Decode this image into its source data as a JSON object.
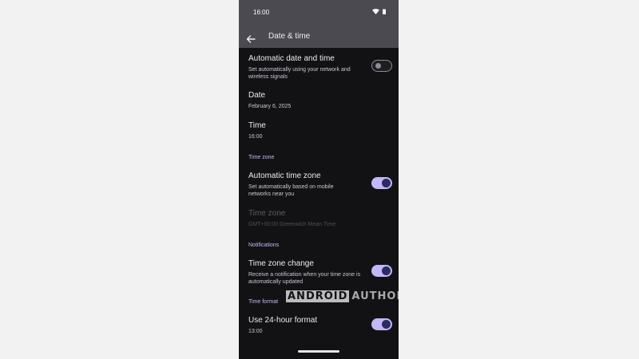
{
  "status_bar": {
    "time": "16:00"
  },
  "app_bar": {
    "title": "Date & time"
  },
  "settings": {
    "auto_date_time": {
      "title": "Automatic date and time",
      "subtitle": "Set automatically using your network and wireless signals",
      "enabled": false
    },
    "date": {
      "title": "Date",
      "value": "February 6, 2025"
    },
    "time": {
      "title": "Time",
      "value": "16:00"
    },
    "time_zone_header": "Time zone",
    "auto_time_zone": {
      "title": "Automatic time zone",
      "subtitle": "Set automatically based on mobile networks near you",
      "enabled": true
    },
    "time_zone": {
      "title": "Time zone",
      "value": "GMT+00:00 Greenwich Mean Time",
      "disabled": true
    },
    "notifications_header": "Notifications",
    "time_zone_change": {
      "title": "Time zone change",
      "subtitle": "Receive a notification when your time zone is automatically updated",
      "enabled": true
    },
    "time_format_header": "Time format",
    "use_24_hour": {
      "title": "Use 24-hour format",
      "value": "13:00",
      "enabled": true
    }
  },
  "watermark": {
    "part1": "ANDROID",
    "part2": "AUTHORITY"
  },
  "colors": {
    "accent": "#c2b8f6",
    "background": "#121214",
    "appbar": "#4b4a50",
    "toggle_knob_on": "#2c2b63"
  }
}
